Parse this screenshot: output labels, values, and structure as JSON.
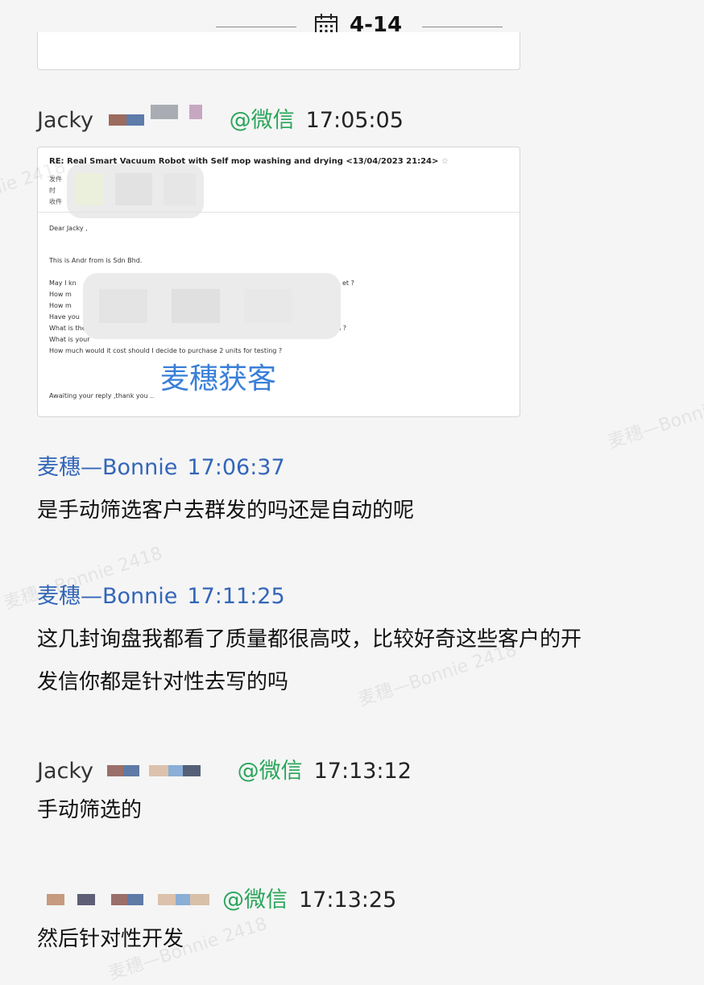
{
  "date_separator": {
    "label": "4-14",
    "icon": "calendar-icon"
  },
  "email_watermark": "麦穗获客",
  "watermark_text": "麦穗—Bonnie 2418",
  "messages": [
    {
      "sender": "Jacky",
      "source": "@微信",
      "time": "17:05:05"
    },
    {
      "sender": "麦穗—Bonnie",
      "time": "17:06:37",
      "text": "是手动筛选客户去群发的吗还是自动的呢"
    },
    {
      "sender": "麦穗—Bonnie",
      "time": "17:11:25",
      "text_line1": "这几封询盘我都看了质量都很高哎，比较好奇这些客户的开",
      "text_line2": "发信你都是针对性去写的吗"
    },
    {
      "sender": "Jacky",
      "source": "@微信",
      "time": "17:13:12",
      "text": "手动筛选的"
    },
    {
      "source": "@微信",
      "time": "17:13:25",
      "text": "然后针对性开发"
    }
  ],
  "email": {
    "subject": "RE: Real Smart Vacuum Robot with Self mop washing and drying <13/04/2023 21:24>",
    "meta_labels": [
      "发件",
      "时",
      "收件"
    ],
    "greeting": "Dear Jacky ,",
    "intro": "This is Andr          from                    is Sdn Bhd.",
    "q1": "May I kn",
    "q1_end": "et ?",
    "q2": "How m",
    "q3": "How m",
    "q4": "Have you",
    "q5": "What is the",
    "q5_end": "egion ?",
    "q6": "What is your",
    "q7": "How much would it cost should I decide to purchase 2 units for testing ?",
    "closing": "Awaiting your reply ,thank you ..",
    "star": "☆"
  },
  "colors": {
    "bonnie": "#3366b8",
    "wechat": "#2aa55b",
    "watermark": "#3a7fd8"
  }
}
